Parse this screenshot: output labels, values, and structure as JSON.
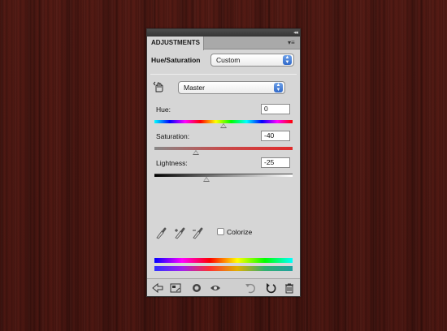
{
  "panel": {
    "tab_label": "ADJUSTMENTS",
    "collapse_glyph": "◂◂",
    "menu_glyph": "▾≡"
  },
  "adjustment": {
    "name": "Hue/Saturation",
    "preset": "Custom",
    "channel": "Master"
  },
  "sliders": {
    "hue": {
      "label": "Hue:",
      "value": "0",
      "fraction": 0.5
    },
    "saturation": {
      "label": "Saturation:",
      "value": "-40",
      "fraction": 0.3
    },
    "lightness": {
      "label": "Lightness:",
      "value": "-25",
      "fraction": 0.375
    }
  },
  "colorize": {
    "label": "Colorize",
    "checked": false
  },
  "icons": [
    "hand-adjust-icon",
    "eyedropper-icon",
    "eyedropper-add-icon",
    "eyedropper-subtract-icon",
    "back-arrow-icon",
    "expand-view-icon",
    "clip-layer-icon",
    "visibility-eye-icon",
    "previous-state-icon",
    "reset-icon",
    "trash-icon"
  ]
}
